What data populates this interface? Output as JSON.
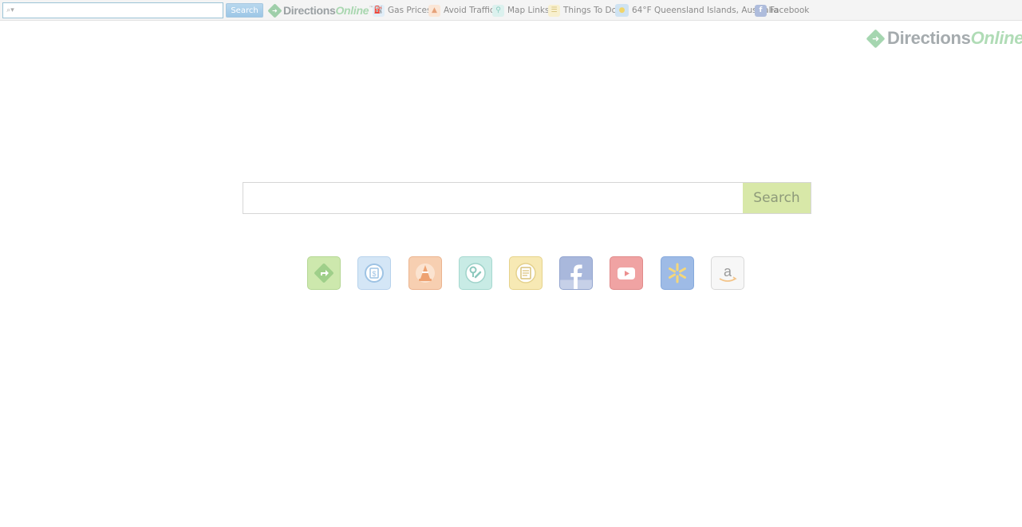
{
  "toolbar": {
    "search_button_label": "Search",
    "search_placeholder": "",
    "search_prefix": "⌕▾",
    "logo_part_a": "Directions",
    "logo_part_b": "Online",
    "logo_tm": "™",
    "items": [
      {
        "label": "Gas Prices",
        "icon": "gas-icon"
      },
      {
        "label": "Avoid Traffic",
        "icon": "traffic-cone-icon"
      },
      {
        "label": "Map Links",
        "icon": "map-pin-icon"
      },
      {
        "label": "Things To Do",
        "icon": "list-icon"
      },
      {
        "label": "64°F Queensland Islands, Australia",
        "icon": "weather-sun-icon"
      },
      {
        "label": "Facebook",
        "icon": "facebook-icon"
      }
    ]
  },
  "main_logo": {
    "part_a": "Directions",
    "part_b": "Online",
    "tm": "™"
  },
  "main_search": {
    "button_label": "Search",
    "placeholder": ""
  },
  "shortcuts": [
    {
      "name": "directions",
      "icon": "directions-icon",
      "color": "#c8e6a6"
    },
    {
      "name": "gas-prices",
      "icon": "gas-price-icon",
      "color": "#cfe2f4"
    },
    {
      "name": "traffic",
      "icon": "traffic-cone-icon",
      "color": "#f6c9a8"
    },
    {
      "name": "map-links",
      "icon": "map-pin-icon",
      "color": "#bfe6e0"
    },
    {
      "name": "things-to-do",
      "icon": "list-icon",
      "color": "#f5e5a8"
    },
    {
      "name": "facebook",
      "icon": "facebook-icon",
      "color": "#9fb0d6"
    },
    {
      "name": "youtube",
      "icon": "youtube-icon",
      "color": "#ef9d9d"
    },
    {
      "name": "walmart",
      "icon": "walmart-icon",
      "color": "#9ab8e4"
    },
    {
      "name": "amazon",
      "icon": "amazon-icon",
      "color": "#f4f4f4"
    }
  ]
}
